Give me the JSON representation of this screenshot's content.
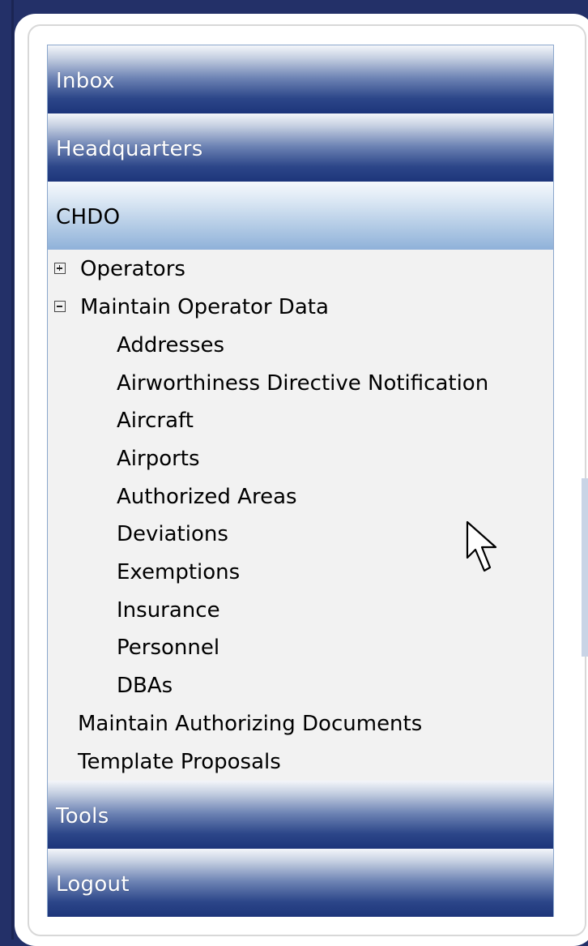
{
  "menu": {
    "inbox": "Inbox",
    "headquarters": "Headquarters",
    "chdo": "CHDO",
    "tools": "Tools",
    "logout": "Logout"
  },
  "tree": {
    "operators": "Operators",
    "maintain_operator_data": "Maintain Operator Data",
    "sub_items": [
      "Addresses",
      "Airworthiness Directive Notification",
      "Aircraft",
      "Airports",
      "Authorized Areas",
      "Deviations",
      "Exemptions",
      "Insurance",
      "Personnel",
      "DBAs"
    ],
    "maintain_authorizing_documents": "Maintain Authorizing Documents",
    "template_proposals": "Template Proposals"
  },
  "colors": {
    "background": "#233068",
    "header_dark": "#1d357a",
    "header_light": "#a9c4e2",
    "tree_background": "#f2f2f2"
  },
  "icons": {
    "expand": "plus-box-icon",
    "collapse": "minus-box-icon",
    "cursor": "mouse-pointer-icon"
  }
}
